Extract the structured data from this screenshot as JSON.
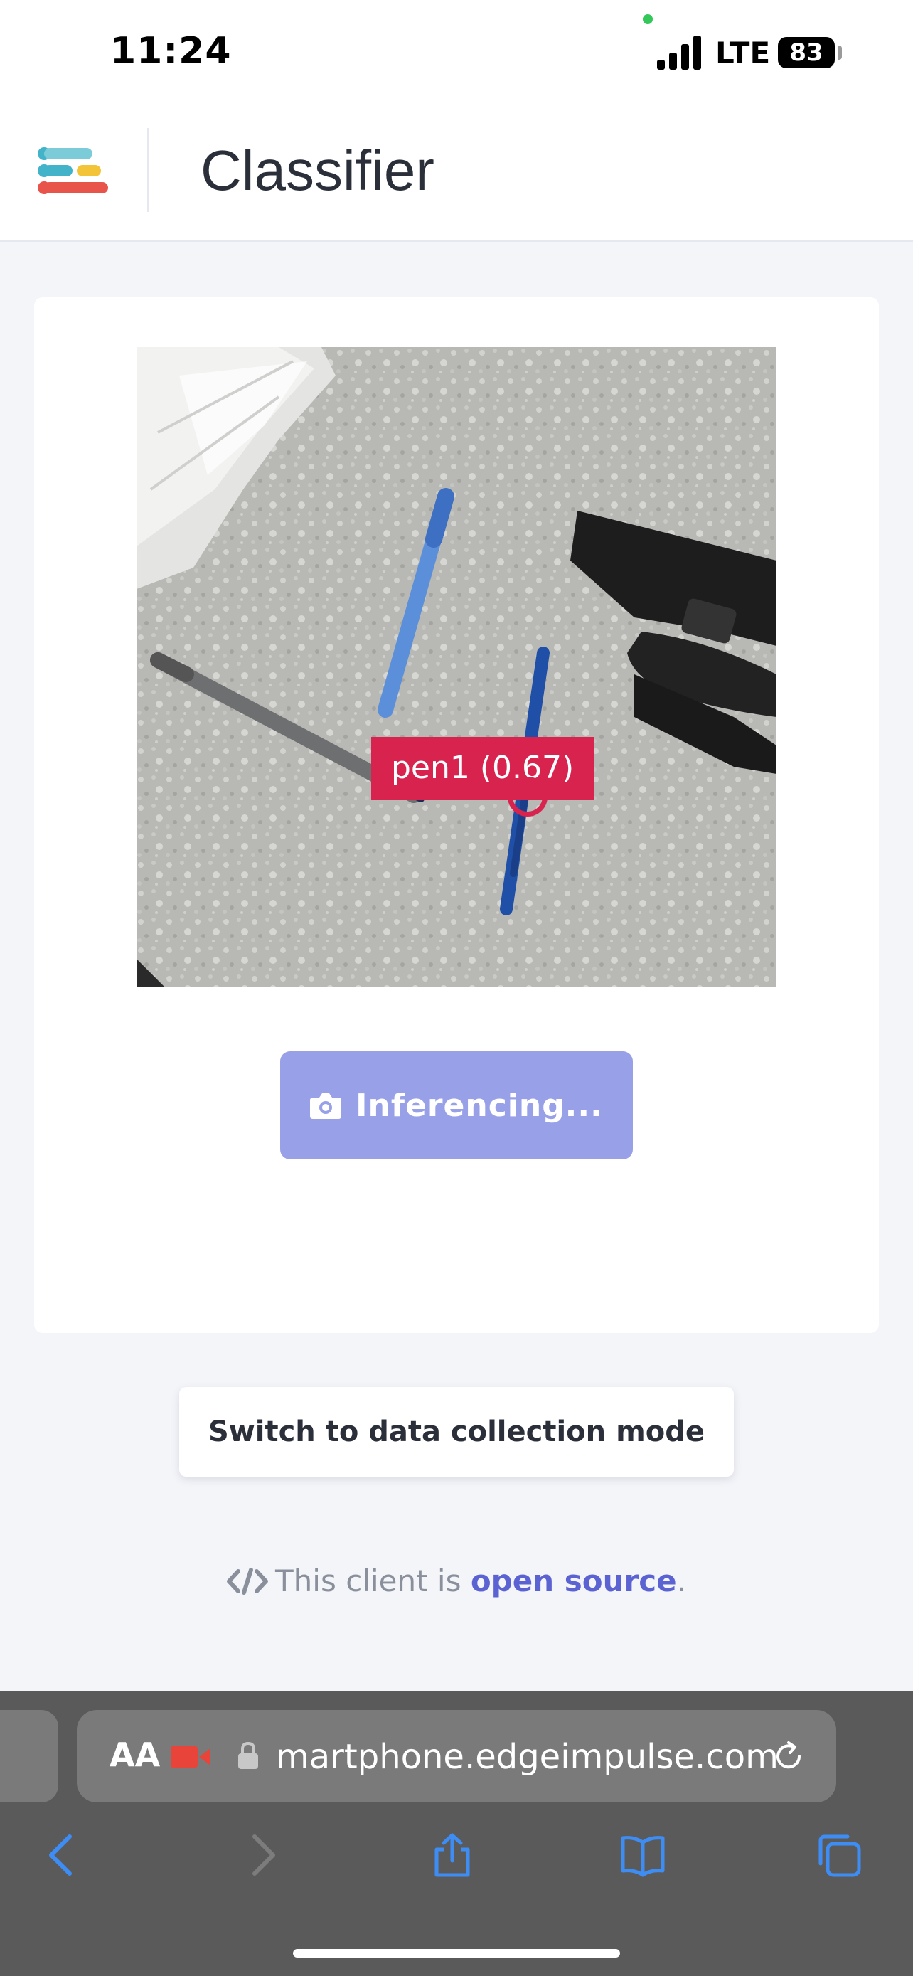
{
  "status_bar": {
    "time": "11:24",
    "network": "LTE",
    "battery": "83"
  },
  "header": {
    "title": "Classifier"
  },
  "classifier": {
    "detection_label": "pen1 (0.67)",
    "inference_button_label": "Inferencing..."
  },
  "switch_mode_label": "Switch to data collection mode",
  "footer": {
    "prefix": "This client is ",
    "link_text": "open source",
    "suffix": "."
  },
  "browser": {
    "font_size_button": "AA",
    "url": "martphone.edgeimpulse.com",
    "icons": [
      "back-icon",
      "forward-icon",
      "share-icon",
      "bookmarks-icon",
      "tabs-icon"
    ]
  },
  "colors": {
    "accent": "#5b63d3",
    "detection": "#d8234f",
    "button_disabled": "#98a0e8",
    "recording": "#e8443a"
  }
}
